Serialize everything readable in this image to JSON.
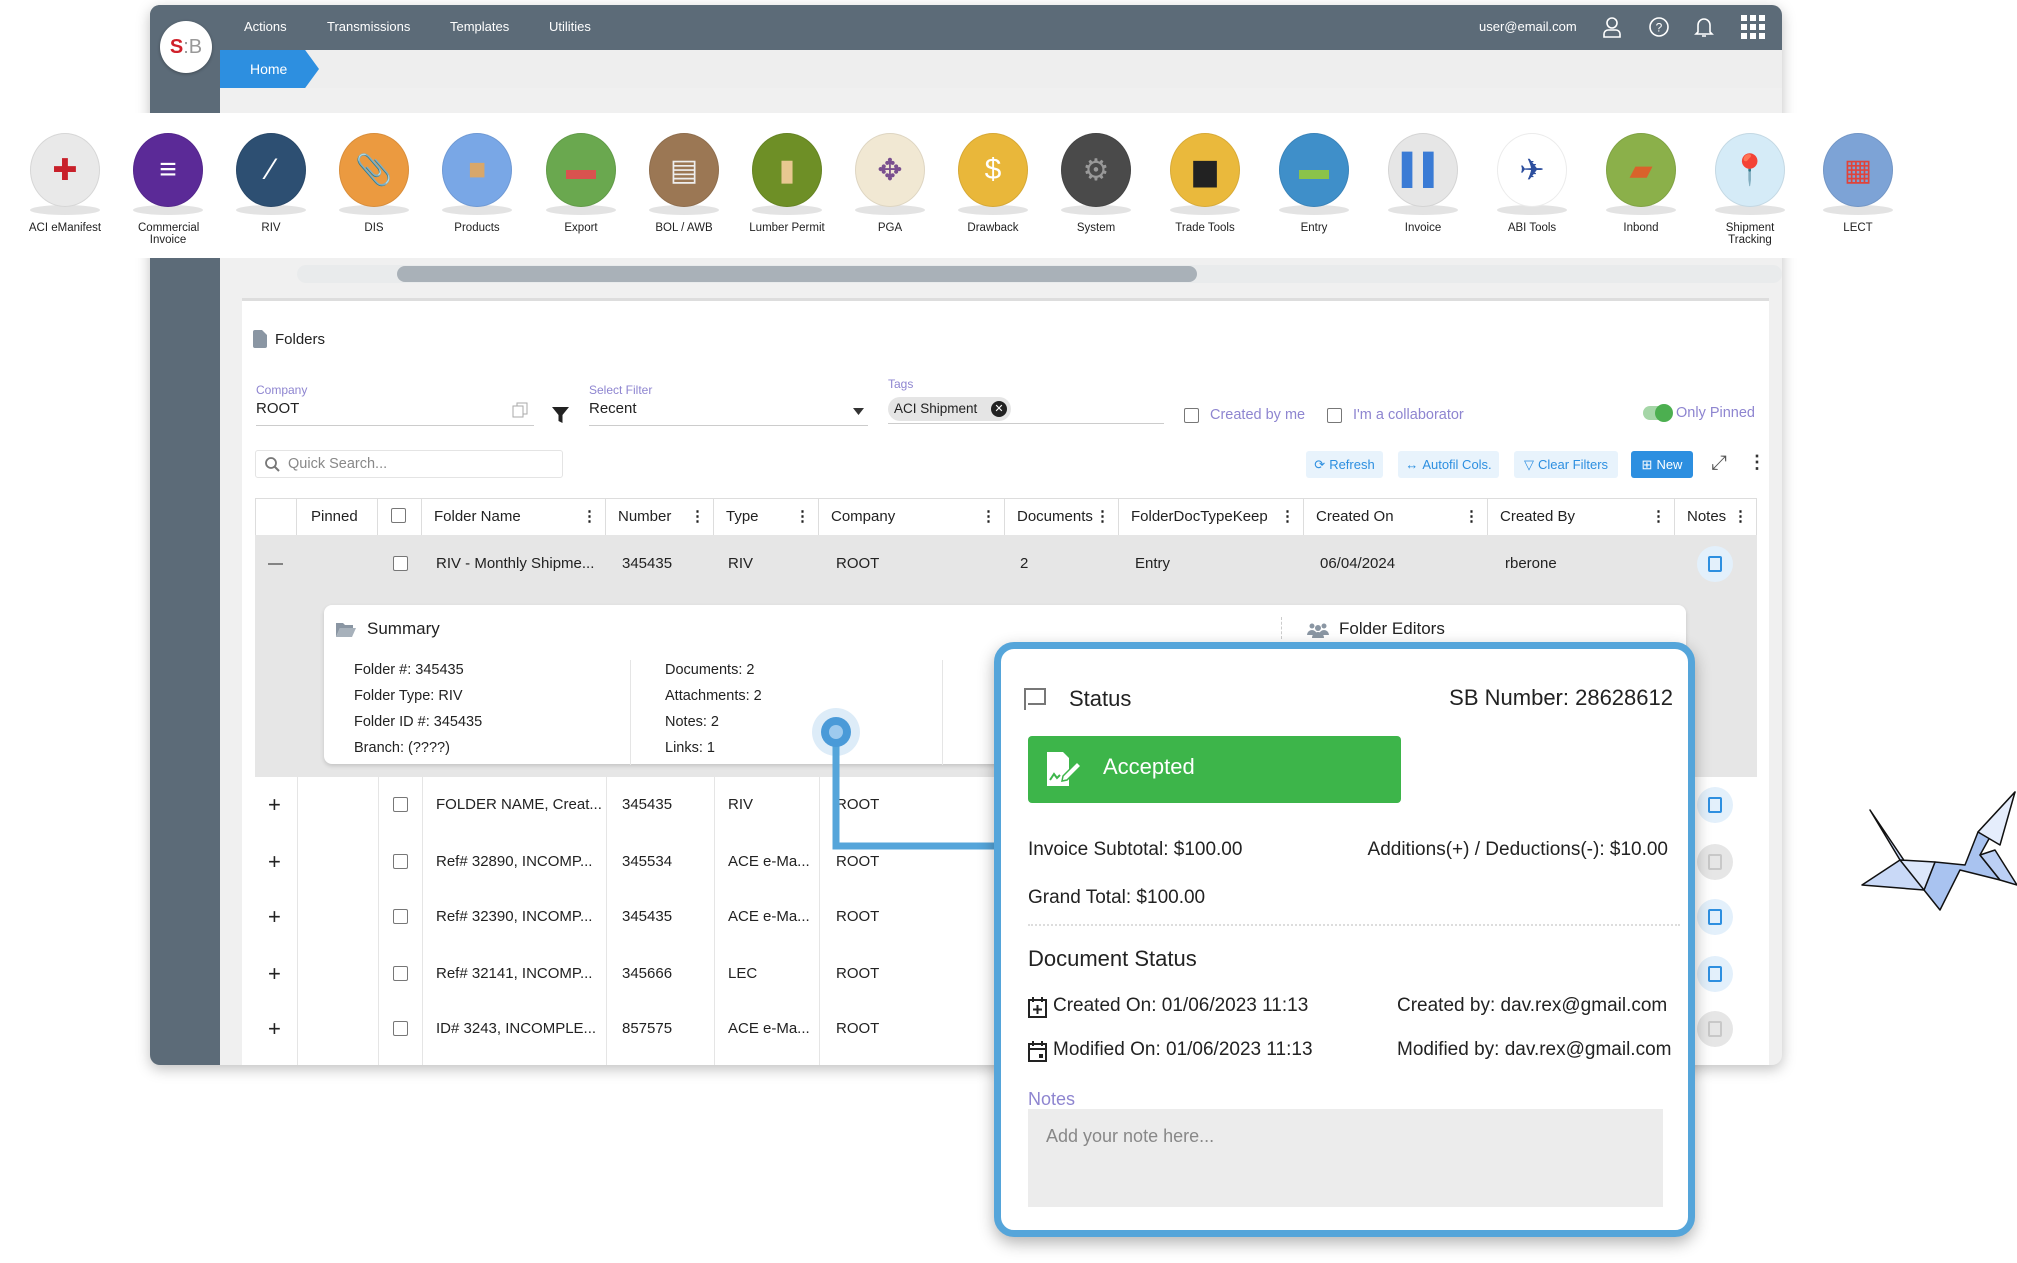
{
  "app": {
    "logo_text": "SB",
    "user_email": "user@email.com"
  },
  "nav": {
    "items": [
      "Actions",
      "Transmissions",
      "Templates",
      "Utilities"
    ]
  },
  "top_icons": [
    "user-icon",
    "help-icon",
    "bell-icon",
    "apps-grid-icon"
  ],
  "breadcrumb": {
    "home": "Home"
  },
  "apps": [
    {
      "label": "ACI eManifest",
      "color": "#e9e9e9",
      "fg": "#c8202a",
      "glyph": "✚"
    },
    {
      "label": "Commercial Invoice",
      "color": "#5b2a97",
      "fg": "#fff",
      "glyph": "≡"
    },
    {
      "label": "RIV",
      "color": "#2d4f72",
      "fg": "#fff",
      "glyph": "⁄"
    },
    {
      "label": "DIS",
      "color": "#eb9a40",
      "fg": "#fff",
      "glyph": "📎"
    },
    {
      "label": "Products",
      "color": "#79a7e6",
      "fg": "#d8a76a",
      "glyph": "■"
    },
    {
      "label": "Export",
      "color": "#6aa84f",
      "fg": "#d9534f",
      "glyph": "▬"
    },
    {
      "label": "BOL / AWB",
      "color": "#9b7754",
      "fg": "#eee",
      "glyph": "▤"
    },
    {
      "label": "Lumber Permit",
      "color": "#6e8f26",
      "fg": "#e8c890",
      "glyph": "▮"
    },
    {
      "label": "PGA",
      "color": "#f1e8d3",
      "fg": "#7a4f8f",
      "glyph": "✥"
    },
    {
      "label": "Drawback",
      "color": "#e9b73a",
      "fg": "#fff",
      "glyph": "$"
    },
    {
      "label": "System",
      "color": "#4a4a4a",
      "fg": "#999",
      "glyph": "⚙"
    },
    {
      "label": "Trade Tools",
      "color": "#eab93c",
      "fg": "#222",
      "glyph": "▆"
    },
    {
      "label": "Entry",
      "color": "#3f8fc9",
      "fg": "#8bc34a",
      "glyph": "▬"
    },
    {
      "label": "Invoice",
      "color": "#e6e6e6",
      "fg": "#3a7bd5",
      "glyph": "▌▌"
    },
    {
      "label": "ABI Tools",
      "color": "#ffffff",
      "fg": "#2d4f9e",
      "glyph": "✈"
    },
    {
      "label": "Inbond",
      "color": "#8bb04a",
      "fg": "#d9622b",
      "glyph": "▰"
    },
    {
      "label": "Shipment Tracking",
      "color": "#d5ebf7",
      "fg": "#e0433a",
      "glyph": "📍"
    },
    {
      "label": "LECT",
      "color": "#7da3d6",
      "fg": "#e0433a",
      "glyph": "▦"
    }
  ],
  "folders": {
    "title": "Folders",
    "company": {
      "label": "Company",
      "value": "ROOT"
    },
    "select_filter": {
      "label": "Select Filter",
      "value": "Recent"
    },
    "tags": {
      "label": "Tags",
      "chips": [
        "ACI Shipment"
      ]
    },
    "created_by_me": {
      "label": "Created by me",
      "checked": false
    },
    "collaborator": {
      "label": "I'm a collaborator",
      "checked": false
    },
    "only_pinned": {
      "label": "Only Pinned",
      "on": true
    },
    "search": {
      "placeholder": "Quick Search..."
    },
    "buttons": {
      "refresh": "Refresh",
      "autofit": "Autofil Cols.",
      "clear_filters": "Clear Filters",
      "new": "New"
    }
  },
  "table": {
    "columns": [
      "",
      "Pinned",
      "",
      "Folder Name",
      "Number",
      "Type",
      "Company",
      "Documents",
      "FolderDocTypeKeep",
      "Created On",
      "Created By",
      "Notes"
    ],
    "rows": [
      {
        "expanded": true,
        "name": "RIV - Monthly Shipme...",
        "number": "345435",
        "type": "RIV",
        "company": "ROOT",
        "documents": "2",
        "doctype": "Entry",
        "created_on": "06/04/2024",
        "created_by": "rberone",
        "has_note": true
      },
      {
        "expanded": false,
        "name": "FOLDER NAME, Creat...",
        "number": "345435",
        "type": "RIV",
        "company": "ROOT",
        "has_note": true
      },
      {
        "expanded": false,
        "name": "Ref# 32890, INCOMP...",
        "number": "345534",
        "type": "ACE e-Ma...",
        "company": "ROOT",
        "has_note": false
      },
      {
        "expanded": false,
        "name": "Ref# 32390, INCOMP...",
        "number": "345435",
        "type": "ACE e-Ma...",
        "company": "ROOT",
        "has_note": true
      },
      {
        "expanded": false,
        "name": "Ref# 32141, INCOMP...",
        "number": "345666",
        "type": "LEC",
        "company": "ROOT",
        "has_note": true
      },
      {
        "expanded": false,
        "name": "ID# 3243, INCOMPLE...",
        "number": "857575",
        "type": "ACE e-Ma...",
        "company": "ROOT",
        "has_note": false
      }
    ]
  },
  "summary": {
    "title": "Summary",
    "col1": [
      "Folder #: 345435",
      "Folder Type: RIV",
      "Folder ID #: 345435",
      "Branch: (????)"
    ],
    "col2": [
      "Documents: 2",
      "Attachments: 2",
      "Notes: 2",
      "Links: 1"
    ],
    "editors_title": "Folder Editors"
  },
  "status": {
    "title": "Status",
    "sb_number": "SB Number: 28628612",
    "badge": "Accepted",
    "badge_color": "#3db54a",
    "invoice_subtotal": "Invoice Subtotal: $100.00",
    "adjustments": "Additions(+) / Deductions(-): $10.00",
    "grand_total": "Grand Total: $100.00",
    "doc_status_title": "Document Status",
    "created_on": "Created On: 01/06/2023 11:13",
    "created_by": "Created by: dav.rex@gmail.com",
    "modified_on": "Modified On: 01/06/2023 11:13",
    "modified_by": "Modified by: dav.rex@gmail.com",
    "notes_label": "Notes",
    "notes_placeholder": "Add your note here..."
  },
  "colors": {
    "accent": "#2d8fe0",
    "navbar": "#5c6b78",
    "popup_border": "#55a5da"
  }
}
